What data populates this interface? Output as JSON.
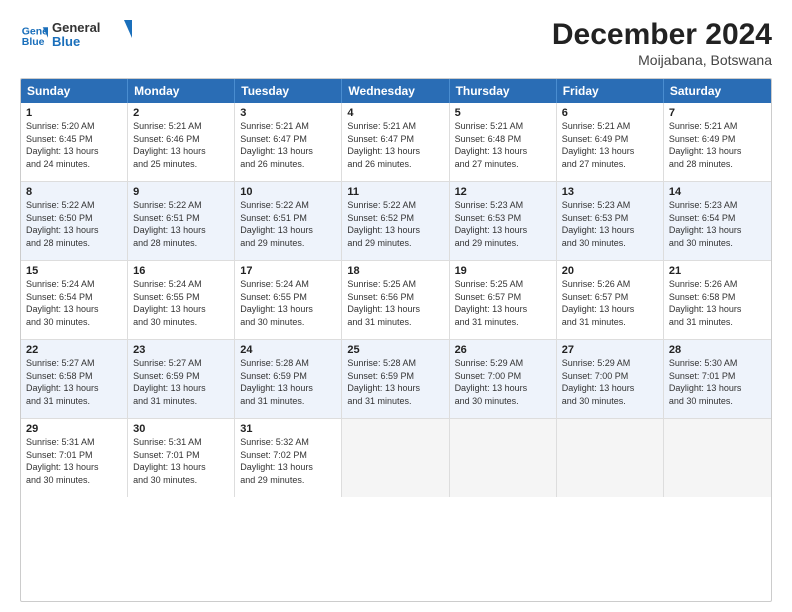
{
  "logo": {
    "line1": "General",
    "line2": "Blue"
  },
  "title": "December 2024",
  "subtitle": "Moijabana, Botswana",
  "days": [
    "Sunday",
    "Monday",
    "Tuesday",
    "Wednesday",
    "Thursday",
    "Friday",
    "Saturday"
  ],
  "rows": [
    [
      {
        "day": 1,
        "lines": [
          "Sunrise: 5:20 AM",
          "Sunset: 6:45 PM",
          "Daylight: 13 hours",
          "and 24 minutes."
        ]
      },
      {
        "day": 2,
        "lines": [
          "Sunrise: 5:21 AM",
          "Sunset: 6:46 PM",
          "Daylight: 13 hours",
          "and 25 minutes."
        ]
      },
      {
        "day": 3,
        "lines": [
          "Sunrise: 5:21 AM",
          "Sunset: 6:47 PM",
          "Daylight: 13 hours",
          "and 26 minutes."
        ]
      },
      {
        "day": 4,
        "lines": [
          "Sunrise: 5:21 AM",
          "Sunset: 6:47 PM",
          "Daylight: 13 hours",
          "and 26 minutes."
        ]
      },
      {
        "day": 5,
        "lines": [
          "Sunrise: 5:21 AM",
          "Sunset: 6:48 PM",
          "Daylight: 13 hours",
          "and 27 minutes."
        ]
      },
      {
        "day": 6,
        "lines": [
          "Sunrise: 5:21 AM",
          "Sunset: 6:49 PM",
          "Daylight: 13 hours",
          "and 27 minutes."
        ]
      },
      {
        "day": 7,
        "lines": [
          "Sunrise: 5:21 AM",
          "Sunset: 6:49 PM",
          "Daylight: 13 hours",
          "and 28 minutes."
        ]
      }
    ],
    [
      {
        "day": 8,
        "lines": [
          "Sunrise: 5:22 AM",
          "Sunset: 6:50 PM",
          "Daylight: 13 hours",
          "and 28 minutes."
        ]
      },
      {
        "day": 9,
        "lines": [
          "Sunrise: 5:22 AM",
          "Sunset: 6:51 PM",
          "Daylight: 13 hours",
          "and 28 minutes."
        ]
      },
      {
        "day": 10,
        "lines": [
          "Sunrise: 5:22 AM",
          "Sunset: 6:51 PM",
          "Daylight: 13 hours",
          "and 29 minutes."
        ]
      },
      {
        "day": 11,
        "lines": [
          "Sunrise: 5:22 AM",
          "Sunset: 6:52 PM",
          "Daylight: 13 hours",
          "and 29 minutes."
        ]
      },
      {
        "day": 12,
        "lines": [
          "Sunrise: 5:23 AM",
          "Sunset: 6:53 PM",
          "Daylight: 13 hours",
          "and 29 minutes."
        ]
      },
      {
        "day": 13,
        "lines": [
          "Sunrise: 5:23 AM",
          "Sunset: 6:53 PM",
          "Daylight: 13 hours",
          "and 30 minutes."
        ]
      },
      {
        "day": 14,
        "lines": [
          "Sunrise: 5:23 AM",
          "Sunset: 6:54 PM",
          "Daylight: 13 hours",
          "and 30 minutes."
        ]
      }
    ],
    [
      {
        "day": 15,
        "lines": [
          "Sunrise: 5:24 AM",
          "Sunset: 6:54 PM",
          "Daylight: 13 hours",
          "and 30 minutes."
        ]
      },
      {
        "day": 16,
        "lines": [
          "Sunrise: 5:24 AM",
          "Sunset: 6:55 PM",
          "Daylight: 13 hours",
          "and 30 minutes."
        ]
      },
      {
        "day": 17,
        "lines": [
          "Sunrise: 5:24 AM",
          "Sunset: 6:55 PM",
          "Daylight: 13 hours",
          "and 30 minutes."
        ]
      },
      {
        "day": 18,
        "lines": [
          "Sunrise: 5:25 AM",
          "Sunset: 6:56 PM",
          "Daylight: 13 hours",
          "and 31 minutes."
        ]
      },
      {
        "day": 19,
        "lines": [
          "Sunrise: 5:25 AM",
          "Sunset: 6:57 PM",
          "Daylight: 13 hours",
          "and 31 minutes."
        ]
      },
      {
        "day": 20,
        "lines": [
          "Sunrise: 5:26 AM",
          "Sunset: 6:57 PM",
          "Daylight: 13 hours",
          "and 31 minutes."
        ]
      },
      {
        "day": 21,
        "lines": [
          "Sunrise: 5:26 AM",
          "Sunset: 6:58 PM",
          "Daylight: 13 hours",
          "and 31 minutes."
        ]
      }
    ],
    [
      {
        "day": 22,
        "lines": [
          "Sunrise: 5:27 AM",
          "Sunset: 6:58 PM",
          "Daylight: 13 hours",
          "and 31 minutes."
        ]
      },
      {
        "day": 23,
        "lines": [
          "Sunrise: 5:27 AM",
          "Sunset: 6:59 PM",
          "Daylight: 13 hours",
          "and 31 minutes."
        ]
      },
      {
        "day": 24,
        "lines": [
          "Sunrise: 5:28 AM",
          "Sunset: 6:59 PM",
          "Daylight: 13 hours",
          "and 31 minutes."
        ]
      },
      {
        "day": 25,
        "lines": [
          "Sunrise: 5:28 AM",
          "Sunset: 6:59 PM",
          "Daylight: 13 hours",
          "and 31 minutes."
        ]
      },
      {
        "day": 26,
        "lines": [
          "Sunrise: 5:29 AM",
          "Sunset: 7:00 PM",
          "Daylight: 13 hours",
          "and 30 minutes."
        ]
      },
      {
        "day": 27,
        "lines": [
          "Sunrise: 5:29 AM",
          "Sunset: 7:00 PM",
          "Daylight: 13 hours",
          "and 30 minutes."
        ]
      },
      {
        "day": 28,
        "lines": [
          "Sunrise: 5:30 AM",
          "Sunset: 7:01 PM",
          "Daylight: 13 hours",
          "and 30 minutes."
        ]
      }
    ],
    [
      {
        "day": 29,
        "lines": [
          "Sunrise: 5:31 AM",
          "Sunset: 7:01 PM",
          "Daylight: 13 hours",
          "and 30 minutes."
        ]
      },
      {
        "day": 30,
        "lines": [
          "Sunrise: 5:31 AM",
          "Sunset: 7:01 PM",
          "Daylight: 13 hours",
          "and 30 minutes."
        ]
      },
      {
        "day": 31,
        "lines": [
          "Sunrise: 5:32 AM",
          "Sunset: 7:02 PM",
          "Daylight: 13 hours",
          "and 29 minutes."
        ]
      },
      {
        "day": null,
        "lines": []
      },
      {
        "day": null,
        "lines": []
      },
      {
        "day": null,
        "lines": []
      },
      {
        "day": null,
        "lines": []
      }
    ]
  ]
}
